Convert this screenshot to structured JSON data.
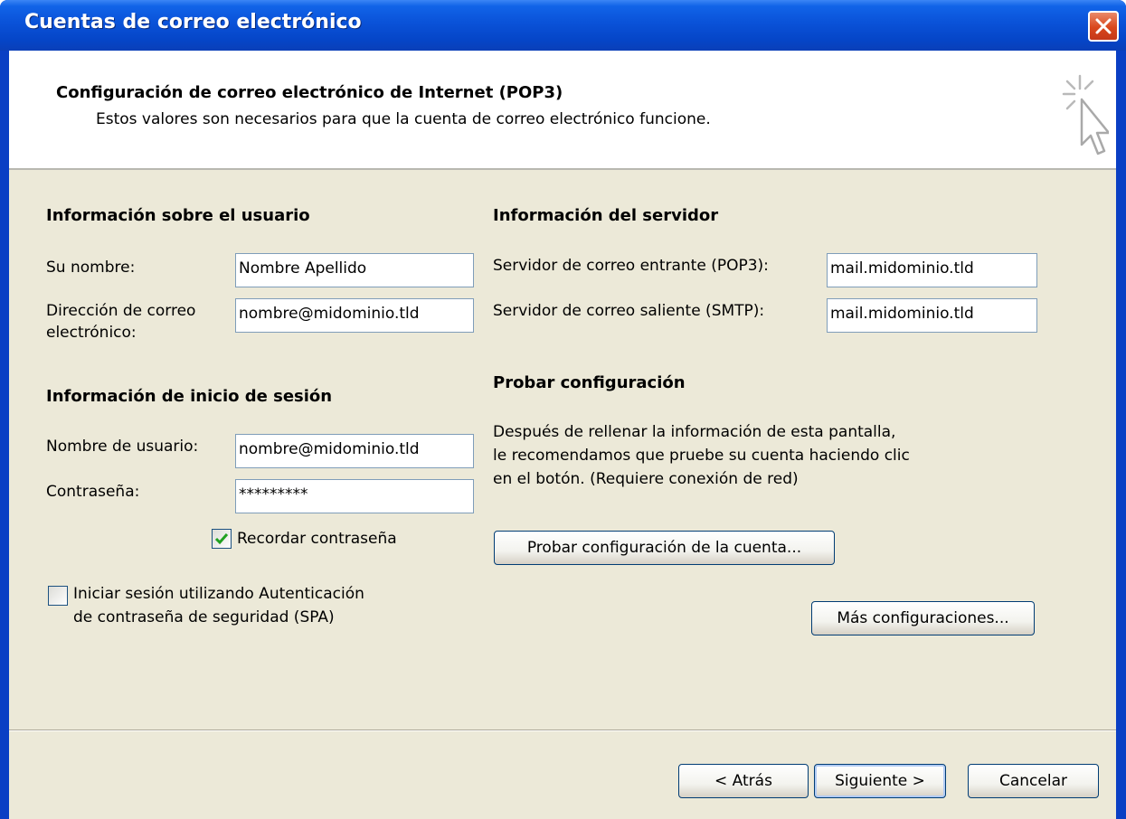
{
  "window": {
    "title": "Cuentas de correo electrónico"
  },
  "header": {
    "title": "Configuración de correo electrónico de Internet (POP3)",
    "subtitle": "Estos valores son necesarios para que la cuenta de correo electrónico funcione."
  },
  "user_info": {
    "heading": "Información sobre el usuario",
    "name_label": "Su nombre:",
    "name_value": "Nombre Apellido",
    "email_label_line1": "Dirección de correo",
    "email_label_line2": "electrónico:",
    "email_value": "nombre@midominio.tld"
  },
  "logon_info": {
    "heading": "Información de inicio de sesión",
    "username_label": "Nombre de usuario:",
    "username_value": "nombre@midominio.tld",
    "password_label": "Contraseña:",
    "password_value": "*********",
    "remember_label": "Recordar contraseña",
    "remember_checked": true,
    "spa_label_line1": "Iniciar sesión utilizando Autenticación",
    "spa_label_line2": "de contraseña de seguridad (SPA)",
    "spa_checked": false
  },
  "server_info": {
    "heading": "Información del servidor",
    "incoming_label": "Servidor de correo entrante (POP3):",
    "incoming_value": "mail.midominio.tld",
    "outgoing_label": "Servidor de correo saliente (SMTP):",
    "outgoing_value": "mail.midominio.tld"
  },
  "test": {
    "heading": "Probar configuración",
    "desc_line1": "Después de rellenar la información de esta pantalla,",
    "desc_line2": "le recomendamos que pruebe su cuenta haciendo clic",
    "desc_line3": "en el botón. (Requiere conexión de red)",
    "test_button": "Probar configuración de la cuenta...",
    "more_button": "Más configuraciones..."
  },
  "footer": {
    "back_button": "< Atrás",
    "next_button": "Siguiente >",
    "cancel_button": "Cancelar"
  },
  "colors": {
    "titlebar": "#0a52d8",
    "dialog_bg": "#ece9d8",
    "check_green": "#21a121",
    "input_border": "#7f9db9"
  },
  "icons": {
    "header": "cursor-sparkle-icon",
    "close": "close-icon",
    "check": "checkmark-icon"
  }
}
